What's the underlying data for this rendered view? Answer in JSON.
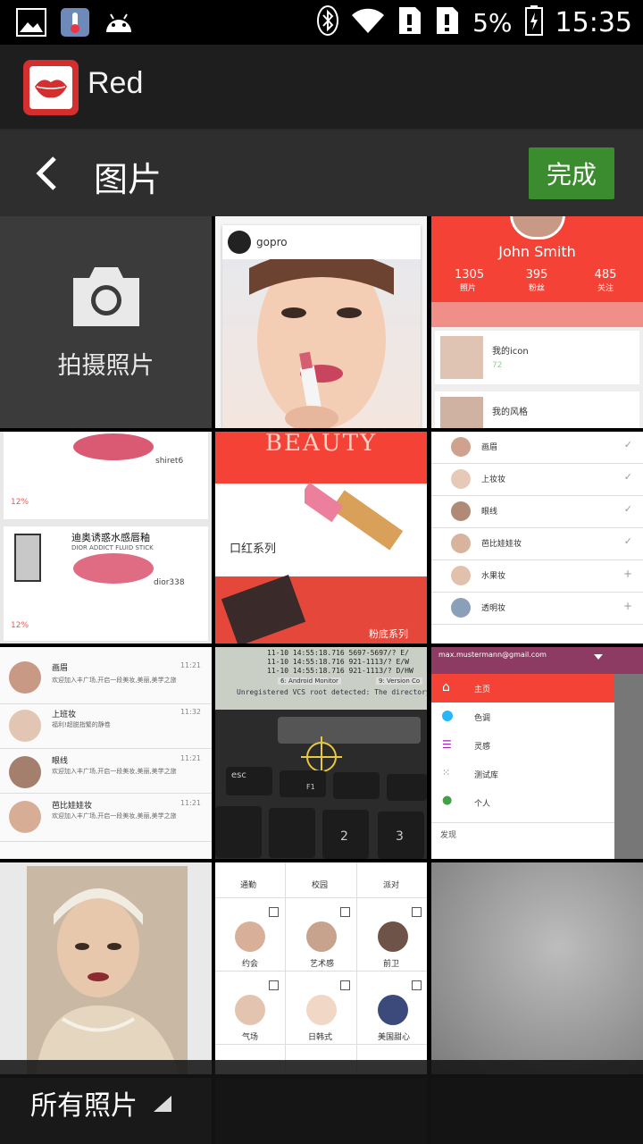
{
  "status": {
    "battery_percent": "5%",
    "time": "15:35"
  },
  "app": {
    "name": "Red"
  },
  "titlebar": {
    "title": "图片",
    "done_label": "完成"
  },
  "camera_tile": {
    "label": "拍摄照片"
  },
  "thumbnails": {
    "t2_brand": "gopro",
    "t3_name": "John Smith",
    "t3_stats": [
      {
        "value": "1305",
        "label": "照片"
      },
      {
        "value": "395",
        "label": "粉丝"
      },
      {
        "value": "485",
        "label": "关注"
      }
    ],
    "t3_items": [
      "我的icon",
      "我的风格"
    ],
    "t3_item_count": "72",
    "t4_author": "shiret6",
    "t4_title": "迪奥诱惑水感唇釉",
    "t4_sub": "DIOR ADDICT FLUID STICK",
    "t4_author2": "dior338",
    "t4_percent": "12%",
    "t5_title": "BEAUTY",
    "t5_label1": "口红系列",
    "t5_label2": "粉底系列",
    "t6_items": [
      "画眉",
      "上妆妆",
      "眼线",
      "芭比娃娃妆",
      "水果妆",
      "透明妆"
    ],
    "t7_items": [
      {
        "name": "画眉",
        "time": "11:21",
        "text": "欢迎加入丰广场,开启一段美妆,美丽,美学之旅"
      },
      {
        "name": "上班妆",
        "time": "11:32",
        "text": "福利!超脱指繁的静卷"
      },
      {
        "name": "眼线",
        "time": "11:21",
        "text": "欢迎加入丰广场,开启一段美妆,美丽,美学之旅"
      },
      {
        "name": "芭比娃娃妆",
        "time": "11:21",
        "text": "欢迎加入丰广场,开启一段美妆,美丽,美学之旅"
      }
    ],
    "t8_console": [
      "11-10 14:55:18.716 5697-5697/? E/",
      "11-10 14:55:18.716 921-1113/? E/W",
      "11-10 14:55:18.716 921-1113/? D/HW",
      "Unregistered VCS root detected: The directory /Users/L"
    ],
    "t8_tabs": [
      "6: Android Monitor",
      "9: Version Co"
    ],
    "t8_keys": [
      "esc",
      "F1",
      "2",
      "3"
    ],
    "t9_email": "max.mustermann@gmail.com",
    "t9_items": [
      "主页",
      "色调",
      "灵感",
      "测试库",
      "个人"
    ],
    "t9_section": "发现",
    "t11_labels": [
      "通勤",
      "校园",
      "派对",
      "约会",
      "艺术感",
      "前卫",
      "气场",
      "日韩式",
      "美国甜心"
    ]
  },
  "bottombar": {
    "album_label": "所有照片"
  },
  "colors": {
    "accent_green": "#3a8c2e",
    "brand_red": "#d32f2f",
    "red_header": "#f44336"
  }
}
